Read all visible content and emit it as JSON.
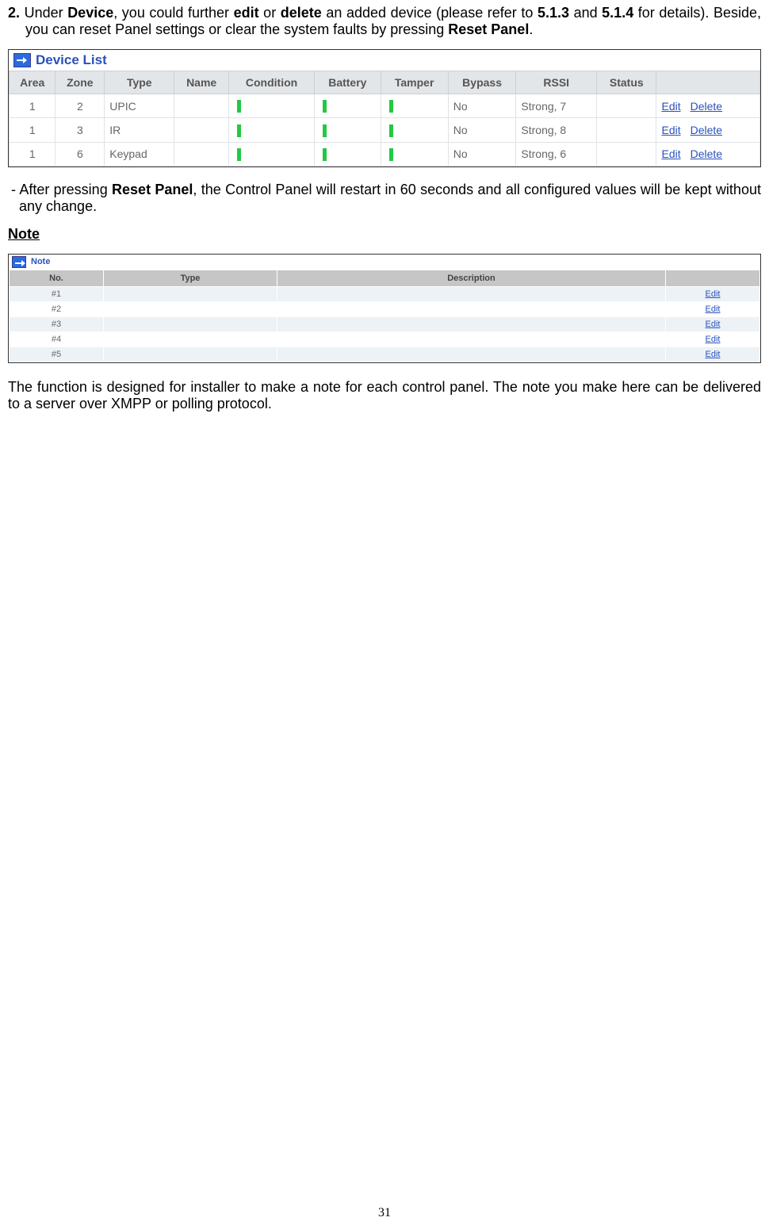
{
  "para1": {
    "num": "2.",
    "t1": " Under ",
    "b1": "Device",
    "t2": ", you could further ",
    "b2": "edit",
    "t3": " or ",
    "b3": "delete",
    "t4": " an added device (please refer to ",
    "b4": "5.1.3",
    "t5": " and ",
    "b5": "5.1.4",
    "t6": " for details). Beside, you can reset Panel settings or clear the system faults by pressing ",
    "b6": "Reset Panel",
    "t7": "."
  },
  "device_list": {
    "title": "Device List",
    "headers": [
      "Area",
      "Zone",
      "Type",
      "Name",
      "Condition",
      "Battery",
      "Tamper",
      "Bypass",
      "RSSI",
      "Status",
      ""
    ],
    "rows": [
      {
        "area": "1",
        "zone": "2",
        "type": "UPIC",
        "name": "",
        "cond": true,
        "batt": true,
        "tamp": true,
        "bypass": "No",
        "rssi": "Strong, 7",
        "status": ""
      },
      {
        "area": "1",
        "zone": "3",
        "type": "IR",
        "name": "",
        "cond": true,
        "batt": true,
        "tamp": true,
        "bypass": "No",
        "rssi": "Strong, 8",
        "status": ""
      },
      {
        "area": "1",
        "zone": "6",
        "type": "Keypad",
        "name": "",
        "cond": true,
        "batt": true,
        "tamp": true,
        "bypass": "No",
        "rssi": "Strong, 6",
        "status": ""
      }
    ],
    "actions": {
      "edit": "Edit",
      "delete": "Delete"
    }
  },
  "para2": {
    "dash": "- ",
    "t1": "After pressing ",
    "b1": "Reset Panel",
    "t2": ", the Control Panel will restart in 60 seconds and all configured values will be kept without any change."
  },
  "note_heading": "Note",
  "note_table": {
    "title": "Note",
    "headers": [
      "No.",
      "Type",
      "Description",
      ""
    ],
    "rows": [
      {
        "no": "#1",
        "type": "",
        "desc": ""
      },
      {
        "no": "#2",
        "type": "",
        "desc": ""
      },
      {
        "no": "#3",
        "type": "",
        "desc": ""
      },
      {
        "no": "#4",
        "type": "",
        "desc": ""
      },
      {
        "no": "#5",
        "type": "",
        "desc": ""
      }
    ],
    "edit": "Edit"
  },
  "para3": "The function is designed for installer to make a note for each control panel. The note you make here can be delivered to a server over XMPP or polling protocol.",
  "page_number": "31"
}
